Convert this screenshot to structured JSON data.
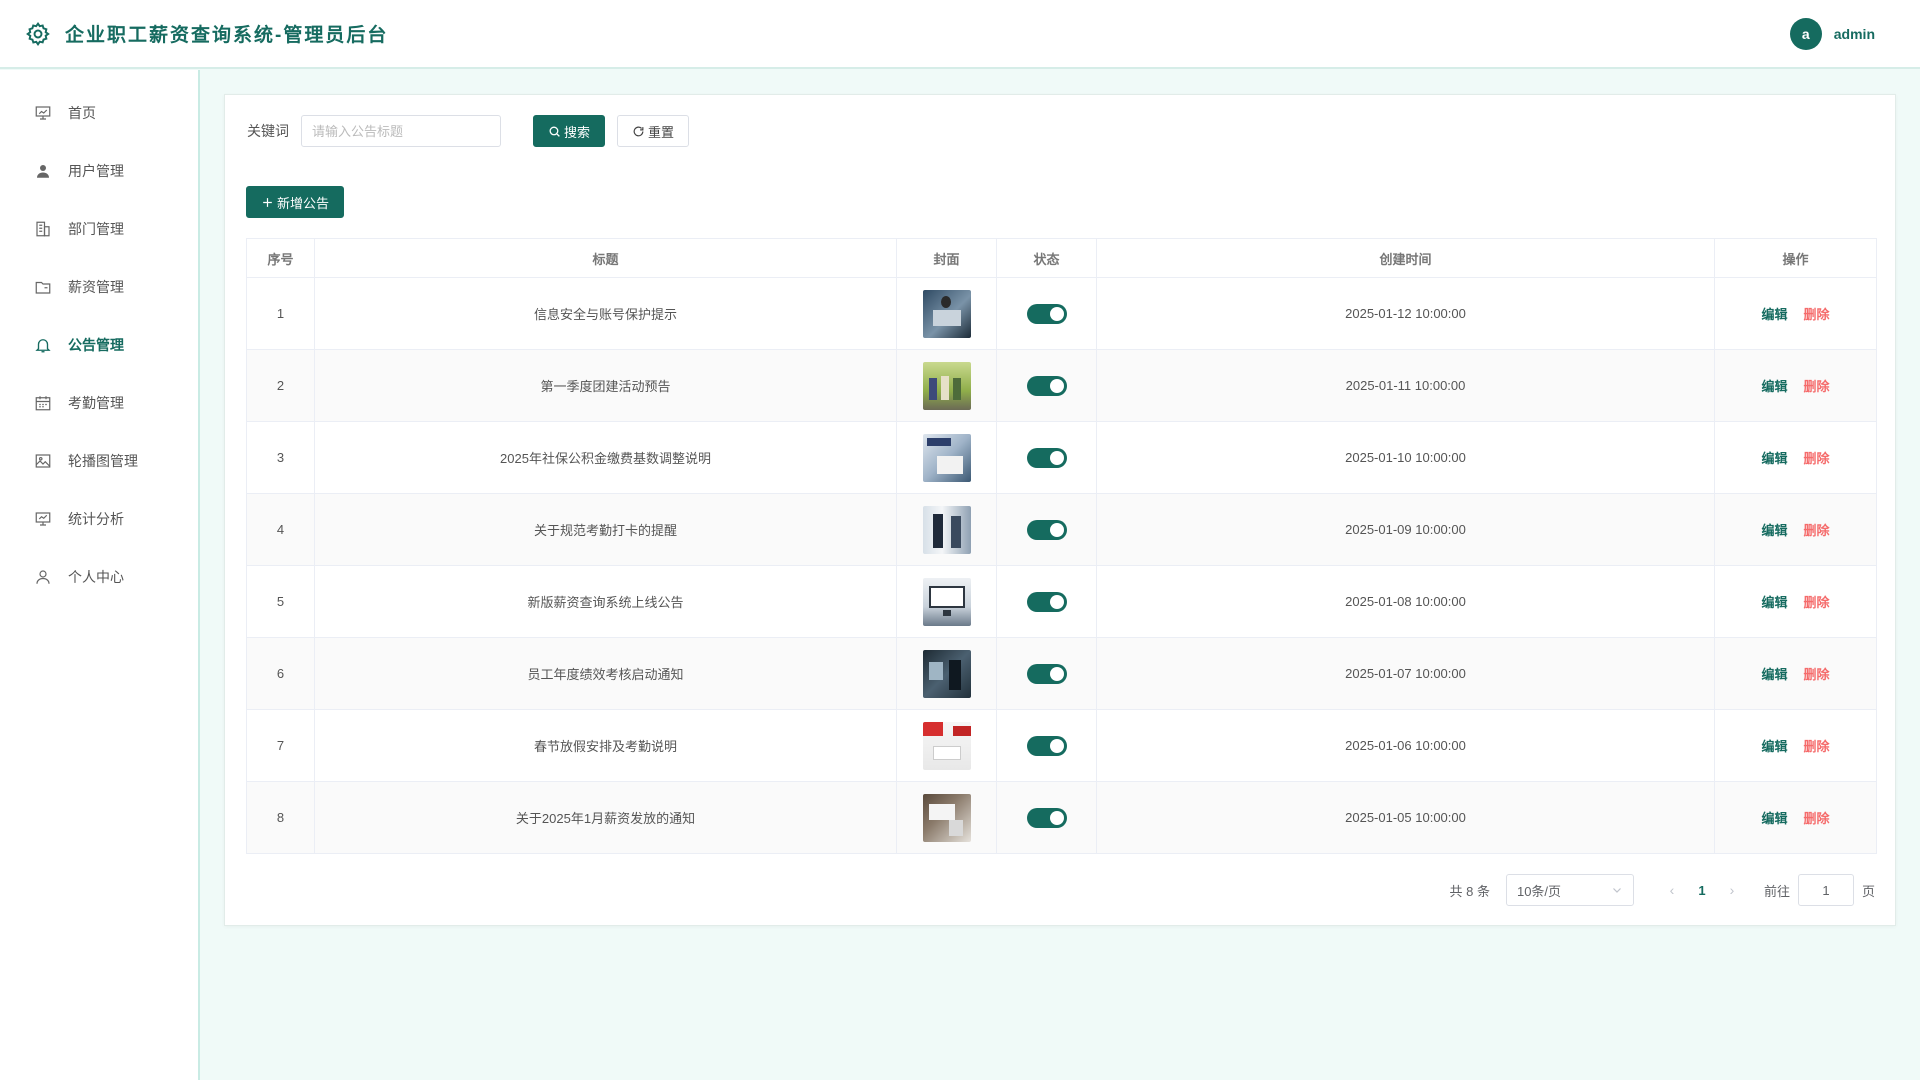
{
  "header": {
    "title": "企业职工薪资查询系统-管理员后台",
    "avatar_letter": "a",
    "username": "admin"
  },
  "sidebar": {
    "items": [
      {
        "label": "首页",
        "icon": "presentation-icon",
        "active": false
      },
      {
        "label": "用户管理",
        "icon": "user-icon",
        "active": false
      },
      {
        "label": "部门管理",
        "icon": "building-icon",
        "active": false
      },
      {
        "label": "薪资管理",
        "icon": "folder-icon",
        "active": false
      },
      {
        "label": "公告管理",
        "icon": "bell-icon",
        "active": true
      },
      {
        "label": "考勤管理",
        "icon": "calendar-icon",
        "active": false
      },
      {
        "label": "轮播图管理",
        "icon": "picture-icon",
        "active": false
      },
      {
        "label": "统计分析",
        "icon": "chart-board-icon",
        "active": false
      },
      {
        "label": "个人中心",
        "icon": "user-outline-icon",
        "active": false
      }
    ]
  },
  "search": {
    "label": "关键词",
    "placeholder": "请输入公告标题",
    "value": "",
    "search_button": "搜索",
    "reset_button": "重置"
  },
  "toolbar": {
    "add_button": "新增公告"
  },
  "table": {
    "columns": [
      "序号",
      "标题",
      "封面",
      "状态",
      "创建时间",
      "操作"
    ],
    "rows": [
      {
        "index": "1",
        "title": "信息安全与账号保护提示",
        "status": true,
        "created": "2025-01-12 10:00:00"
      },
      {
        "index": "2",
        "title": "第一季度团建活动预告",
        "status": true,
        "created": "2025-01-11 10:00:00"
      },
      {
        "index": "3",
        "title": "2025年社保公积金缴费基数调整说明",
        "status": true,
        "created": "2025-01-10 10:00:00"
      },
      {
        "index": "4",
        "title": "关于规范考勤打卡的提醒",
        "status": true,
        "created": "2025-01-09 10:00:00"
      },
      {
        "index": "5",
        "title": "新版薪资查询系统上线公告",
        "status": true,
        "created": "2025-01-08 10:00:00"
      },
      {
        "index": "6",
        "title": "员工年度绩效考核启动通知",
        "status": true,
        "created": "2025-01-07 10:00:00"
      },
      {
        "index": "7",
        "title": "春节放假安排及考勤说明",
        "status": true,
        "created": "2025-01-06 10:00:00"
      },
      {
        "index": "8",
        "title": "关于2025年1月薪资发放的通知",
        "status": true,
        "created": "2025-01-05 10:00:00"
      }
    ],
    "edit_label": "编辑",
    "delete_label": "删除"
  },
  "pagination": {
    "total_text": "共 8 条",
    "page_size": "10条/页",
    "current_page": "1",
    "goto_label": "前往",
    "goto_value": "1",
    "page_suffix": "页"
  },
  "colors": {
    "primary": "#156b5f",
    "danger": "#f56c6c",
    "background": "#f0faf8"
  }
}
